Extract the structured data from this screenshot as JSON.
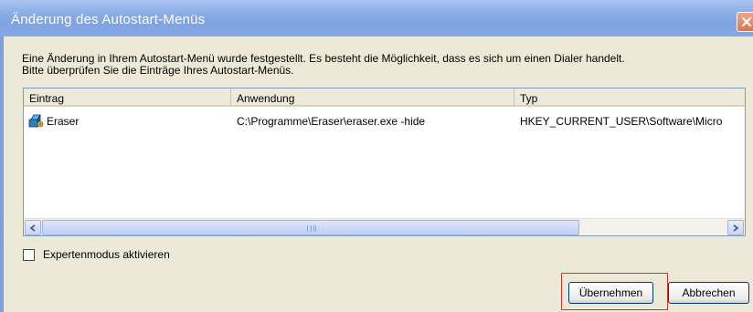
{
  "window": {
    "title": "Änderung des Autostart-Menüs"
  },
  "description": {
    "line1": "Eine Änderung in Ihrem Autostart-Menü wurde festgestellt. Es besteht die Möglichkeit, dass es sich um einen Dialer handelt.",
    "line2": "Bitte überprüfen Sie die Einträge Ihres Autostart-Menüs."
  },
  "listview": {
    "columns": [
      "Eintrag",
      "Anwendung",
      "Typ"
    ],
    "rows": [
      {
        "entry": "Eraser",
        "application": "C:\\Programme\\Eraser\\eraser.exe -hide",
        "type": "HKEY_CURRENT_USER\\Software\\Micro",
        "icon": "eraser-app-icon"
      }
    ]
  },
  "expert_mode": {
    "label": "Expertenmodus aktivieren",
    "checked": false
  },
  "buttons": {
    "apply": "Übernehmen",
    "cancel": "Abbrechen"
  },
  "colors": {
    "highlight": "#e0302a",
    "titlebar": "#8fb1e8"
  }
}
